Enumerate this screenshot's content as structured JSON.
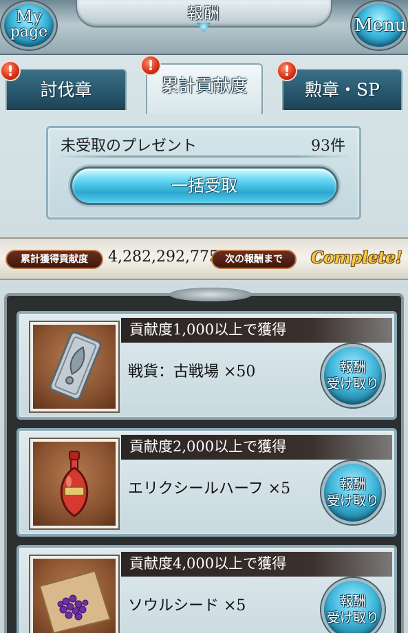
{
  "header": {
    "title": "報酬",
    "mypage_line1": "My",
    "mypage_line2": "page",
    "menu_label": "Menu"
  },
  "tabs": [
    {
      "label": "討伐章",
      "active": false,
      "badge": "!"
    },
    {
      "label": "累計貢献度",
      "active": true,
      "badge": "!"
    },
    {
      "label": "勲章・SP",
      "active": false,
      "badge": "!"
    }
  ],
  "present": {
    "label": "未受取のプレゼント",
    "count": "93件",
    "claim_all_label": "一括受取"
  },
  "contribution": {
    "total_label": "累計獲得貢献度",
    "total_value": "4,282,292,775",
    "next_label": "次の報酬まで",
    "status": "Complete!"
  },
  "rewards": [
    {
      "condition": "貢献度1,000以上で獲得",
      "item": "戦貨：古戦場 ×50",
      "icon": "war-medal-icon",
      "button_l1": "報酬",
      "button_l2": "受け取り"
    },
    {
      "condition": "貢献度2,000以上で獲得",
      "item": "エリクシールハーフ ×5",
      "icon": "elixir-potion-icon",
      "button_l1": "報酬",
      "button_l2": "受け取り"
    },
    {
      "condition": "貢献度4,000以上で獲得",
      "item": "ソウルシード ×5",
      "icon": "soul-seed-icon",
      "button_l1": "報酬",
      "button_l2": "受け取り"
    }
  ]
}
